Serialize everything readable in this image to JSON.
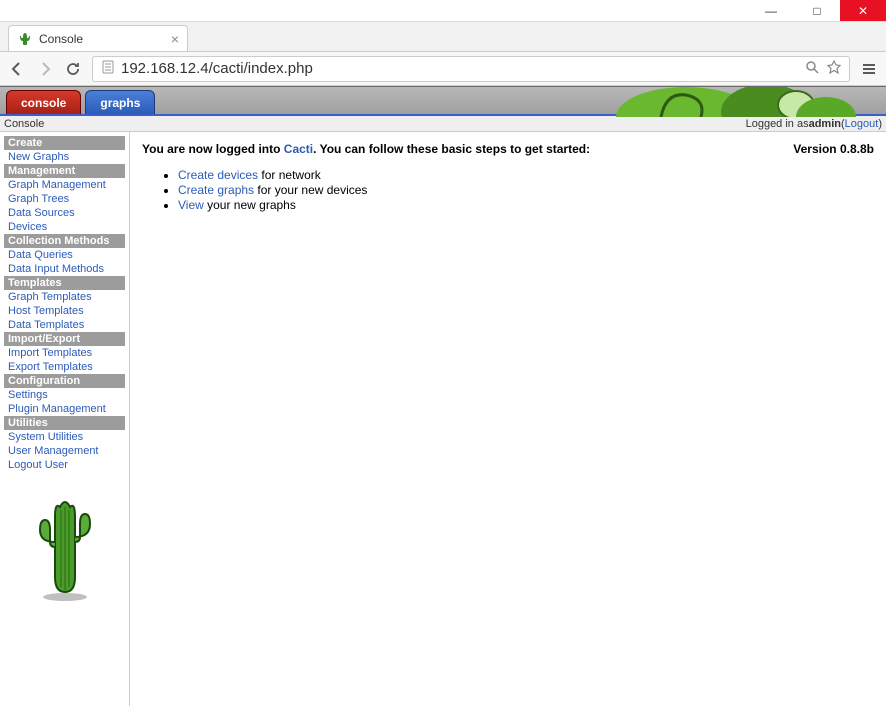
{
  "window": {
    "min": "—",
    "max": "□",
    "close": "✕"
  },
  "browser": {
    "tab_title": "Console",
    "tab_close": "×",
    "url": "192.168.12.4/cacti/index.php"
  },
  "cacti_tabs": {
    "console": "console",
    "graphs": "graphs"
  },
  "info_bar": {
    "left": "Console",
    "logged_in_prefix": "Logged in as ",
    "user": "admin",
    "logout_open": " (",
    "logout": "Logout",
    "logout_close": ")"
  },
  "sidebar": {
    "s0": "Create",
    "l0": "New Graphs",
    "s1": "Management",
    "l1": "Graph Management",
    "l2": "Graph Trees",
    "l3": "Data Sources",
    "l4": "Devices",
    "s2": "Collection Methods",
    "l5": "Data Queries",
    "l6": "Data Input Methods",
    "s3": "Templates",
    "l7": "Graph Templates",
    "l8": "Host Templates",
    "l9": "Data Templates",
    "s4": "Import/Export",
    "l10": "Import Templates",
    "l11": "Export Templates",
    "s5": "Configuration",
    "l12": "Settings",
    "l13": "Plugin Management",
    "s6": "Utilities",
    "l14": "System Utilities",
    "l15": "User Management",
    "l16": "Logout User"
  },
  "content": {
    "msg_pre": "You are now logged into ",
    "cacti": "Cacti",
    "msg_post": ". You can follow these basic steps to get started:",
    "version": "Version 0.8.8b",
    "step1_link": "Create devices",
    "step1_text": " for network",
    "step2_link": "Create graphs",
    "step2_text": " for your new devices",
    "step3_link": "View",
    "step3_text": " your new graphs"
  }
}
